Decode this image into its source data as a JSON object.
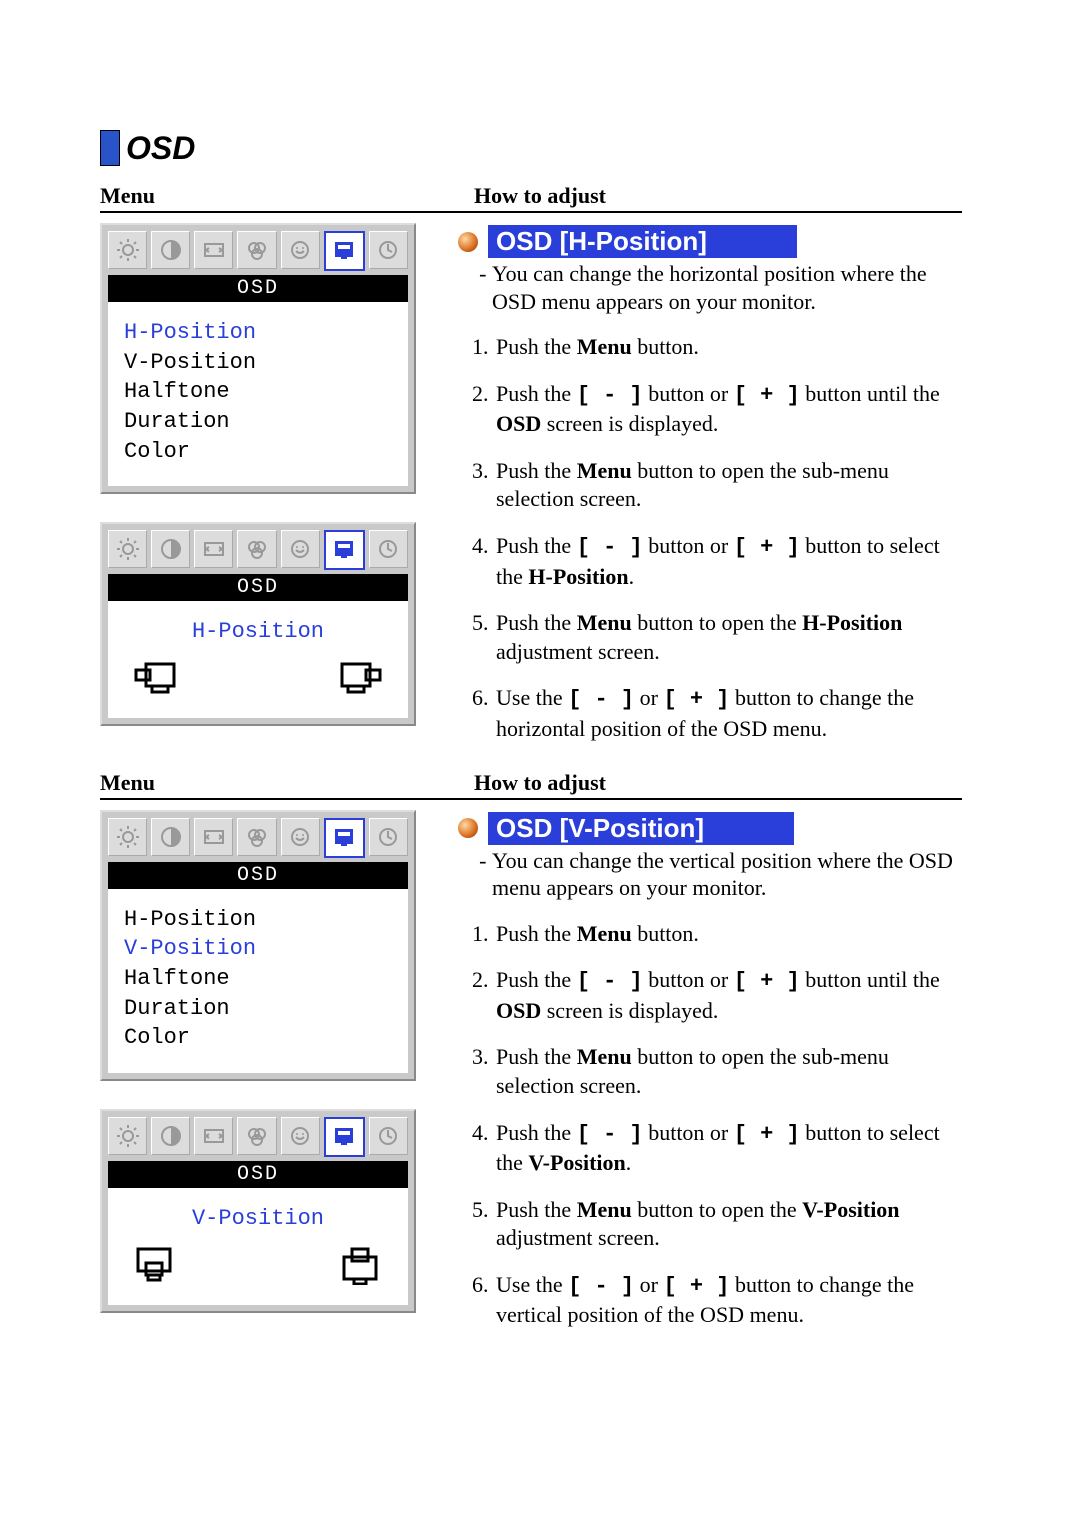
{
  "heading": "OSD",
  "labels": {
    "menu": "Menu",
    "howto": "How to adjust"
  },
  "osd_panel": {
    "title": "OSD",
    "items": [
      "H-Position",
      "V-Position",
      "Halftone",
      "Duration",
      "Color"
    ],
    "adj_h_label": "H-Position",
    "adj_v_label": "V-Position"
  },
  "sections": [
    {
      "feature_title": "OSD [H-Position]",
      "desc": "You can change the horizontal position where the OSD menu appears on your monitor.",
      "selected_item": "H-Position",
      "adj_label_key": "adj_h_label",
      "adj_icon": "h",
      "steps": {
        "s1_pre": "Push the ",
        "s1_b": "Menu",
        "s1_post": " button.",
        "s2_pre": "Push the ",
        "s2_x": "[ - ]",
        "s2_mid": "  button or ",
        "s2_y": "[ + ]",
        "s2_post": "  button until the ",
        "s2_b": "OSD",
        "s2_end": " screen is displayed.",
        "s3_pre": "Push the ",
        "s3_b": "Menu",
        "s3_post": " button to open the sub-menu selection screen.",
        "s4_pre": "Push the ",
        "s4_x": "[ - ]",
        "s4_mid": "  button or ",
        "s4_y": "[ + ]",
        "s4_post": " button to select the ",
        "s4_b": "H-Position",
        "s4_end": ".",
        "s5_pre": "Push the ",
        "s5_b1": "Menu",
        "s5_mid": " button to open the ",
        "s5_b2": "H-Position",
        "s5_post": " adjustment screen.",
        "s6_pre": "Use the ",
        "s6_x": "[ - ]",
        "s6_mid": " or ",
        "s6_y": "[ + ]",
        "s6_post": " button to change the horizontal position of the OSD menu."
      }
    },
    {
      "feature_title": "OSD [V-Position]",
      "desc": "You can change the vertical position where the OSD menu appears on your monitor.",
      "selected_item": "V-Position",
      "adj_label_key": "adj_v_label",
      "adj_icon": "v",
      "steps": {
        "s1_pre": "Push the ",
        "s1_b": "Menu",
        "s1_post": " button.",
        "s2_pre": "Push the ",
        "s2_x": "[ - ]",
        "s2_mid": "  button or ",
        "s2_y": "[ + ]",
        "s2_post": "  button until the ",
        "s2_b": "OSD",
        "s2_end": " screen is displayed.",
        "s3_pre": "Push the ",
        "s3_b": "Menu",
        "s3_post": " button to open the sub-menu selection screen.",
        "s4_pre": "Push the ",
        "s4_x": "[ - ]",
        "s4_mid": "  button or ",
        "s4_y": "[ + ]",
        "s4_post": " button to select the ",
        "s4_b": "V-Position",
        "s4_end": ".",
        "s5_pre": "Push the ",
        "s5_b1": "Menu",
        "s5_mid": " button to open the ",
        "s5_b2": "V-Position",
        "s5_post": " adjustment screen.",
        "s6_pre": "Use the ",
        "s6_x": "[ - ]",
        "s6_mid": " or ",
        "s6_y": "[ + ]",
        "s6_post": " button to change the vertical position of the OSD menu."
      }
    }
  ]
}
